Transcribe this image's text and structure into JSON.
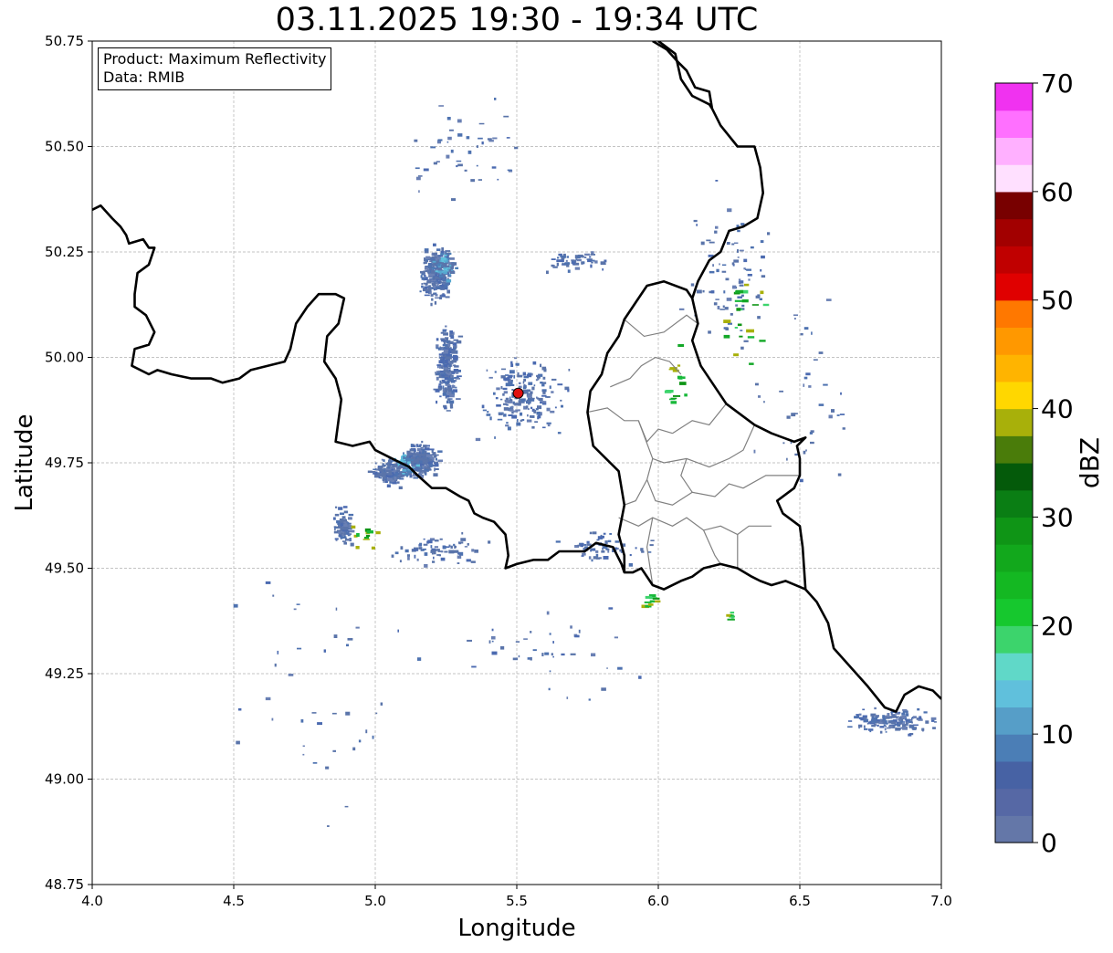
{
  "title": "03.11.2025 19:30 - 19:34 UTC",
  "info": {
    "product": "Product: Maximum Reflectivity",
    "source": "Data: RMIB"
  },
  "axes": {
    "xlabel": "Longitude",
    "ylabel": "Latitude",
    "xlim": [
      4.0,
      7.0
    ],
    "ylim": [
      48.75,
      50.75
    ],
    "xticks": [
      "4.0",
      "4.5",
      "5.0",
      "5.5",
      "6.0",
      "6.5",
      "7.0"
    ],
    "yticks": [
      "48.75",
      "49.00",
      "49.25",
      "49.50",
      "49.75",
      "50.00",
      "50.25",
      "50.50",
      "50.75"
    ],
    "grid": true
  },
  "radar_site": {
    "lon": 5.505,
    "lat": 49.915,
    "color": "#e01010"
  },
  "colorbar": {
    "label": "dBZ",
    "min": 0,
    "max": 70,
    "step": 2.5,
    "ticks": [
      "0",
      "10",
      "20",
      "30",
      "40",
      "50",
      "60",
      "70"
    ],
    "colors": [
      "#6477a8",
      "#5668a5",
      "#4762a4",
      "#4b7eb6",
      "#569ec8",
      "#60c0dc",
      "#60d8c8",
      "#3cd46c",
      "#16c82e",
      "#14b822",
      "#12a81c",
      "#0f9516",
      "#0a7e14",
      "#045a0a",
      "#4a7c0a",
      "#a8b00a",
      "#ffd700",
      "#ffb400",
      "#ff9800",
      "#ff7800",
      "#e00000",
      "#c00000",
      "#a20000",
      "#780000",
      "#ffe0ff",
      "#ffb0ff",
      "#ff70ff",
      "#f032f0"
    ]
  },
  "colors": {
    "border_national": "#000000",
    "border_regional": "#808080",
    "grid": "#b0b0b0",
    "echo_weak": "#5a74aa",
    "echo_light": "#56a8d0",
    "echo_green": "#18b83a"
  },
  "borders": {
    "national": [
      [
        [
          4.0,
          50.35
        ],
        [
          4.03,
          50.36
        ],
        [
          4.07,
          50.33
        ],
        [
          4.1,
          50.31
        ],
        [
          4.12,
          50.29
        ],
        [
          4.13,
          50.27
        ],
        [
          4.18,
          50.28
        ],
        [
          4.2,
          50.26
        ],
        [
          4.22,
          50.26
        ],
        [
          4.2,
          50.22
        ],
        [
          4.16,
          50.2
        ],
        [
          4.15,
          50.15
        ],
        [
          4.15,
          50.12
        ],
        [
          4.19,
          50.1
        ],
        [
          4.22,
          50.06
        ],
        [
          4.2,
          50.03
        ],
        [
          4.15,
          50.02
        ],
        [
          4.14,
          49.98
        ],
        [
          4.2,
          49.96
        ],
        [
          4.23,
          49.97
        ],
        [
          4.28,
          49.96
        ],
        [
          4.35,
          49.95
        ],
        [
          4.42,
          49.95
        ],
        [
          4.46,
          49.94
        ],
        [
          4.52,
          49.95
        ],
        [
          4.56,
          49.97
        ],
        [
          4.62,
          49.98
        ],
        [
          4.68,
          49.99
        ],
        [
          4.7,
          50.02
        ],
        [
          4.72,
          50.08
        ],
        [
          4.76,
          50.12
        ],
        [
          4.8,
          50.15
        ],
        [
          4.86,
          50.15
        ],
        [
          4.89,
          50.14
        ],
        [
          4.87,
          50.08
        ],
        [
          4.83,
          50.05
        ],
        [
          4.82,
          49.99
        ],
        [
          4.86,
          49.95
        ],
        [
          4.88,
          49.9
        ],
        [
          4.86,
          49.8
        ],
        [
          4.92,
          49.79
        ],
        [
          4.98,
          49.8
        ],
        [
          5.0,
          49.78
        ],
        [
          5.06,
          49.76
        ],
        [
          5.12,
          49.74
        ],
        [
          5.15,
          49.72
        ],
        [
          5.2,
          49.69
        ],
        [
          5.25,
          49.69
        ],
        [
          5.3,
          49.67
        ],
        [
          5.33,
          49.66
        ],
        [
          5.35,
          49.63
        ],
        [
          5.38,
          49.62
        ],
        [
          5.42,
          49.61
        ],
        [
          5.46,
          49.58
        ],
        [
          5.47,
          49.53
        ],
        [
          5.46,
          49.5
        ],
        [
          5.5,
          49.51
        ],
        [
          5.56,
          49.52
        ],
        [
          5.61,
          49.52
        ],
        [
          5.65,
          49.54
        ],
        [
          5.7,
          49.54
        ],
        [
          5.74,
          49.54
        ],
        [
          5.78,
          49.56
        ],
        [
          5.84,
          49.55
        ],
        [
          5.87,
          49.51
        ],
        [
          5.88,
          49.49
        ],
        [
          5.91,
          49.49
        ],
        [
          5.94,
          49.5
        ],
        [
          5.98,
          49.46
        ],
        [
          6.02,
          49.45
        ],
        [
          6.08,
          49.47
        ],
        [
          6.12,
          49.48
        ],
        [
          6.16,
          49.5
        ],
        [
          6.22,
          49.51
        ],
        [
          6.28,
          49.5
        ],
        [
          6.33,
          49.48
        ],
        [
          6.36,
          49.47
        ],
        [
          6.4,
          49.46
        ],
        [
          6.45,
          49.47
        ],
        [
          6.52,
          49.45
        ],
        [
          6.56,
          49.42
        ],
        [
          6.6,
          49.37
        ],
        [
          6.62,
          49.31
        ],
        [
          6.66,
          49.28
        ],
        [
          6.7,
          49.25
        ],
        [
          6.74,
          49.22
        ],
        [
          6.8,
          49.17
        ],
        [
          6.84,
          49.16
        ],
        [
          6.87,
          49.2
        ],
        [
          6.92,
          49.22
        ],
        [
          6.97,
          49.21
        ],
        [
          7.0,
          49.19
        ]
      ],
      [
        [
          6.52,
          49.45
        ],
        [
          6.51,
          49.55
        ],
        [
          6.5,
          49.6
        ],
        [
          6.44,
          49.63
        ],
        [
          6.42,
          49.66
        ],
        [
          6.48,
          49.69
        ],
        [
          6.5,
          49.72
        ],
        [
          6.5,
          49.76
        ],
        [
          6.49,
          49.79
        ],
        [
          6.52,
          49.81
        ],
        [
          6.48,
          49.8
        ],
        [
          6.44,
          49.81
        ],
        [
          6.4,
          49.82
        ],
        [
          6.34,
          49.84
        ],
        [
          6.3,
          49.86
        ],
        [
          6.24,
          49.89
        ],
        [
          6.2,
          49.93
        ],
        [
          6.15,
          49.98
        ],
        [
          6.12,
          50.04
        ],
        [
          6.14,
          50.08
        ],
        [
          6.12,
          50.14
        ],
        [
          6.1,
          50.16
        ],
        [
          6.02,
          50.18
        ],
        [
          5.96,
          50.17
        ],
        [
          5.92,
          50.13
        ],
        [
          5.88,
          50.09
        ],
        [
          5.86,
          50.05
        ],
        [
          5.82,
          50.01
        ],
        [
          5.8,
          49.96
        ],
        [
          5.76,
          49.92
        ],
        [
          5.75,
          49.87
        ],
        [
          5.77,
          49.79
        ],
        [
          5.86,
          49.73
        ],
        [
          5.88,
          49.65
        ],
        [
          5.86,
          49.58
        ],
        [
          5.88,
          49.53
        ],
        [
          5.88,
          49.49
        ]
      ],
      [
        [
          6.12,
          50.14
        ],
        [
          6.14,
          50.18
        ],
        [
          6.18,
          50.23
        ],
        [
          6.22,
          50.25
        ],
        [
          6.25,
          50.3
        ],
        [
          6.3,
          50.31
        ],
        [
          6.35,
          50.33
        ],
        [
          6.37,
          50.39
        ],
        [
          6.36,
          50.45
        ],
        [
          6.34,
          50.5
        ],
        [
          6.28,
          50.5
        ],
        [
          6.22,
          50.55
        ],
        [
          6.19,
          50.59
        ],
        [
          6.18,
          50.63
        ],
        [
          6.13,
          50.64
        ],
        [
          6.1,
          50.68
        ],
        [
          6.07,
          50.7
        ],
        [
          6.03,
          50.73
        ],
        [
          5.98,
          50.75
        ]
      ],
      [
        [
          6.19,
          50.59
        ],
        [
          6.18,
          50.6
        ],
        [
          6.12,
          50.62
        ],
        [
          6.08,
          50.66
        ],
        [
          6.06,
          50.72
        ],
        [
          6.02,
          50.74
        ],
        [
          6.0,
          50.75
        ]
      ]
    ],
    "regional": [
      [
        [
          5.83,
          49.93
        ],
        [
          5.9,
          49.95
        ],
        [
          5.94,
          49.98
        ],
        [
          5.99,
          50.0
        ],
        [
          6.04,
          49.99
        ],
        [
          6.08,
          49.96
        ]
      ],
      [
        [
          5.75,
          49.87
        ],
        [
          5.82,
          49.88
        ],
        [
          5.88,
          49.85
        ],
        [
          5.93,
          49.85
        ],
        [
          5.96,
          49.8
        ],
        [
          6.0,
          49.83
        ],
        [
          6.05,
          49.82
        ]
      ],
      [
        [
          5.93,
          49.85
        ],
        [
          5.98,
          49.76
        ],
        [
          6.02,
          49.75
        ],
        [
          6.1,
          49.76
        ],
        [
          6.18,
          49.74
        ],
        [
          6.25,
          49.76
        ],
        [
          6.3,
          49.78
        ],
        [
          6.34,
          49.84
        ]
      ],
      [
        [
          5.98,
          49.76
        ],
        [
          5.96,
          49.71
        ],
        [
          5.99,
          49.66
        ],
        [
          6.05,
          49.65
        ],
        [
          6.12,
          49.68
        ],
        [
          6.2,
          49.67
        ],
        [
          6.25,
          49.7
        ],
        [
          6.3,
          49.69
        ],
        [
          6.38,
          49.72
        ],
        [
          6.44,
          49.72
        ],
        [
          6.5,
          49.72
        ]
      ],
      [
        [
          5.86,
          49.62
        ],
        [
          5.93,
          49.6
        ],
        [
          5.98,
          49.62
        ],
        [
          6.05,
          49.6
        ],
        [
          6.1,
          49.62
        ],
        [
          6.16,
          49.59
        ],
        [
          6.22,
          49.6
        ],
        [
          6.28,
          49.58
        ],
        [
          6.32,
          49.6
        ],
        [
          6.4,
          49.6
        ]
      ],
      [
        [
          5.96,
          49.71
        ],
        [
          5.92,
          49.66
        ],
        [
          5.88,
          49.65
        ]
      ],
      [
        [
          6.05,
          49.82
        ],
        [
          6.12,
          49.85
        ],
        [
          6.18,
          49.84
        ],
        [
          6.24,
          49.89
        ]
      ],
      [
        [
          6.1,
          49.76
        ],
        [
          6.08,
          49.72
        ],
        [
          6.12,
          49.68
        ]
      ],
      [
        [
          6.16,
          49.59
        ],
        [
          6.2,
          49.53
        ],
        [
          6.22,
          49.51
        ]
      ],
      [
        [
          5.98,
          49.62
        ],
        [
          5.96,
          49.55
        ],
        [
          5.98,
          49.46
        ]
      ],
      [
        [
          6.28,
          49.58
        ],
        [
          6.28,
          49.52
        ],
        [
          6.28,
          49.5
        ]
      ],
      [
        [
          5.88,
          50.09
        ],
        [
          5.95,
          50.05
        ],
        [
          6.02,
          50.06
        ],
        [
          6.1,
          50.1
        ],
        [
          6.14,
          50.08
        ]
      ]
    ]
  },
  "echo_clusters": [
    {
      "lon": 5.21,
      "lat": 50.2,
      "rlon": 0.07,
      "rlat": 0.08,
      "n": 260,
      "palette": "weak"
    },
    {
      "lon": 5.24,
      "lat": 50.22,
      "rlon": 0.05,
      "rlat": 0.04,
      "n": 60,
      "palette": "light"
    },
    {
      "lon": 5.25,
      "lat": 49.98,
      "rlon": 0.05,
      "rlat": 0.12,
      "n": 260,
      "palette": "weak"
    },
    {
      "lon": 5.16,
      "lat": 49.76,
      "rlon": 0.07,
      "rlat": 0.05,
      "n": 240,
      "palette": "weak"
    },
    {
      "lon": 5.05,
      "lat": 49.73,
      "rlon": 0.09,
      "rlat": 0.04,
      "n": 180,
      "palette": "weak"
    },
    {
      "lon": 5.1,
      "lat": 49.75,
      "rlon": 0.05,
      "rlat": 0.03,
      "n": 50,
      "palette": "light"
    },
    {
      "lon": 4.88,
      "lat": 49.6,
      "rlon": 0.04,
      "rlat": 0.06,
      "n": 100,
      "palette": "weak"
    },
    {
      "lon": 5.52,
      "lat": 49.91,
      "rlon": 0.2,
      "rlat": 0.12,
      "n": 180,
      "palette": "weak"
    },
    {
      "lon": 5.7,
      "lat": 50.23,
      "rlon": 0.16,
      "rlat": 0.03,
      "n": 60,
      "palette": "weak"
    },
    {
      "lon": 5.22,
      "lat": 49.55,
      "rlon": 0.22,
      "rlat": 0.05,
      "n": 70,
      "palette": "weak"
    },
    {
      "lon": 5.8,
      "lat": 49.55,
      "rlon": 0.22,
      "rlat": 0.05,
      "n": 60,
      "palette": "weak"
    },
    {
      "lon": 6.25,
      "lat": 50.2,
      "rlon": 0.2,
      "rlat": 0.25,
      "n": 80,
      "palette": "weak"
    },
    {
      "lon": 6.3,
      "lat": 50.1,
      "rlon": 0.12,
      "rlat": 0.15,
      "n": 22,
      "palette": "green"
    },
    {
      "lon": 6.05,
      "lat": 49.95,
      "rlon": 0.06,
      "rlat": 0.1,
      "n": 16,
      "palette": "green"
    },
    {
      "lon": 6.82,
      "lat": 49.14,
      "rlon": 0.18,
      "rlat": 0.04,
      "n": 150,
      "palette": "weak"
    },
    {
      "lon": 6.5,
      "lat": 49.9,
      "rlon": 0.25,
      "rlat": 0.3,
      "n": 40,
      "palette": "weak"
    },
    {
      "lon": 5.3,
      "lat": 50.5,
      "rlon": 0.3,
      "rlat": 0.15,
      "n": 45,
      "palette": "weak"
    },
    {
      "lon": 4.8,
      "lat": 49.2,
      "rlon": 0.5,
      "rlat": 0.4,
      "n": 40,
      "palette": "weak"
    },
    {
      "lon": 5.6,
      "lat": 49.3,
      "rlon": 0.4,
      "rlat": 0.15,
      "n": 40,
      "palette": "weak"
    },
    {
      "lon": 4.95,
      "lat": 49.58,
      "rlon": 0.06,
      "rlat": 0.04,
      "n": 12,
      "palette": "green"
    },
    {
      "lon": 5.95,
      "lat": 49.42,
      "rlon": 0.05,
      "rlat": 0.03,
      "n": 10,
      "palette": "green"
    },
    {
      "lon": 6.25,
      "lat": 49.39,
      "rlon": 0.02,
      "rlat": 0.02,
      "n": 6,
      "palette": "green"
    }
  ]
}
